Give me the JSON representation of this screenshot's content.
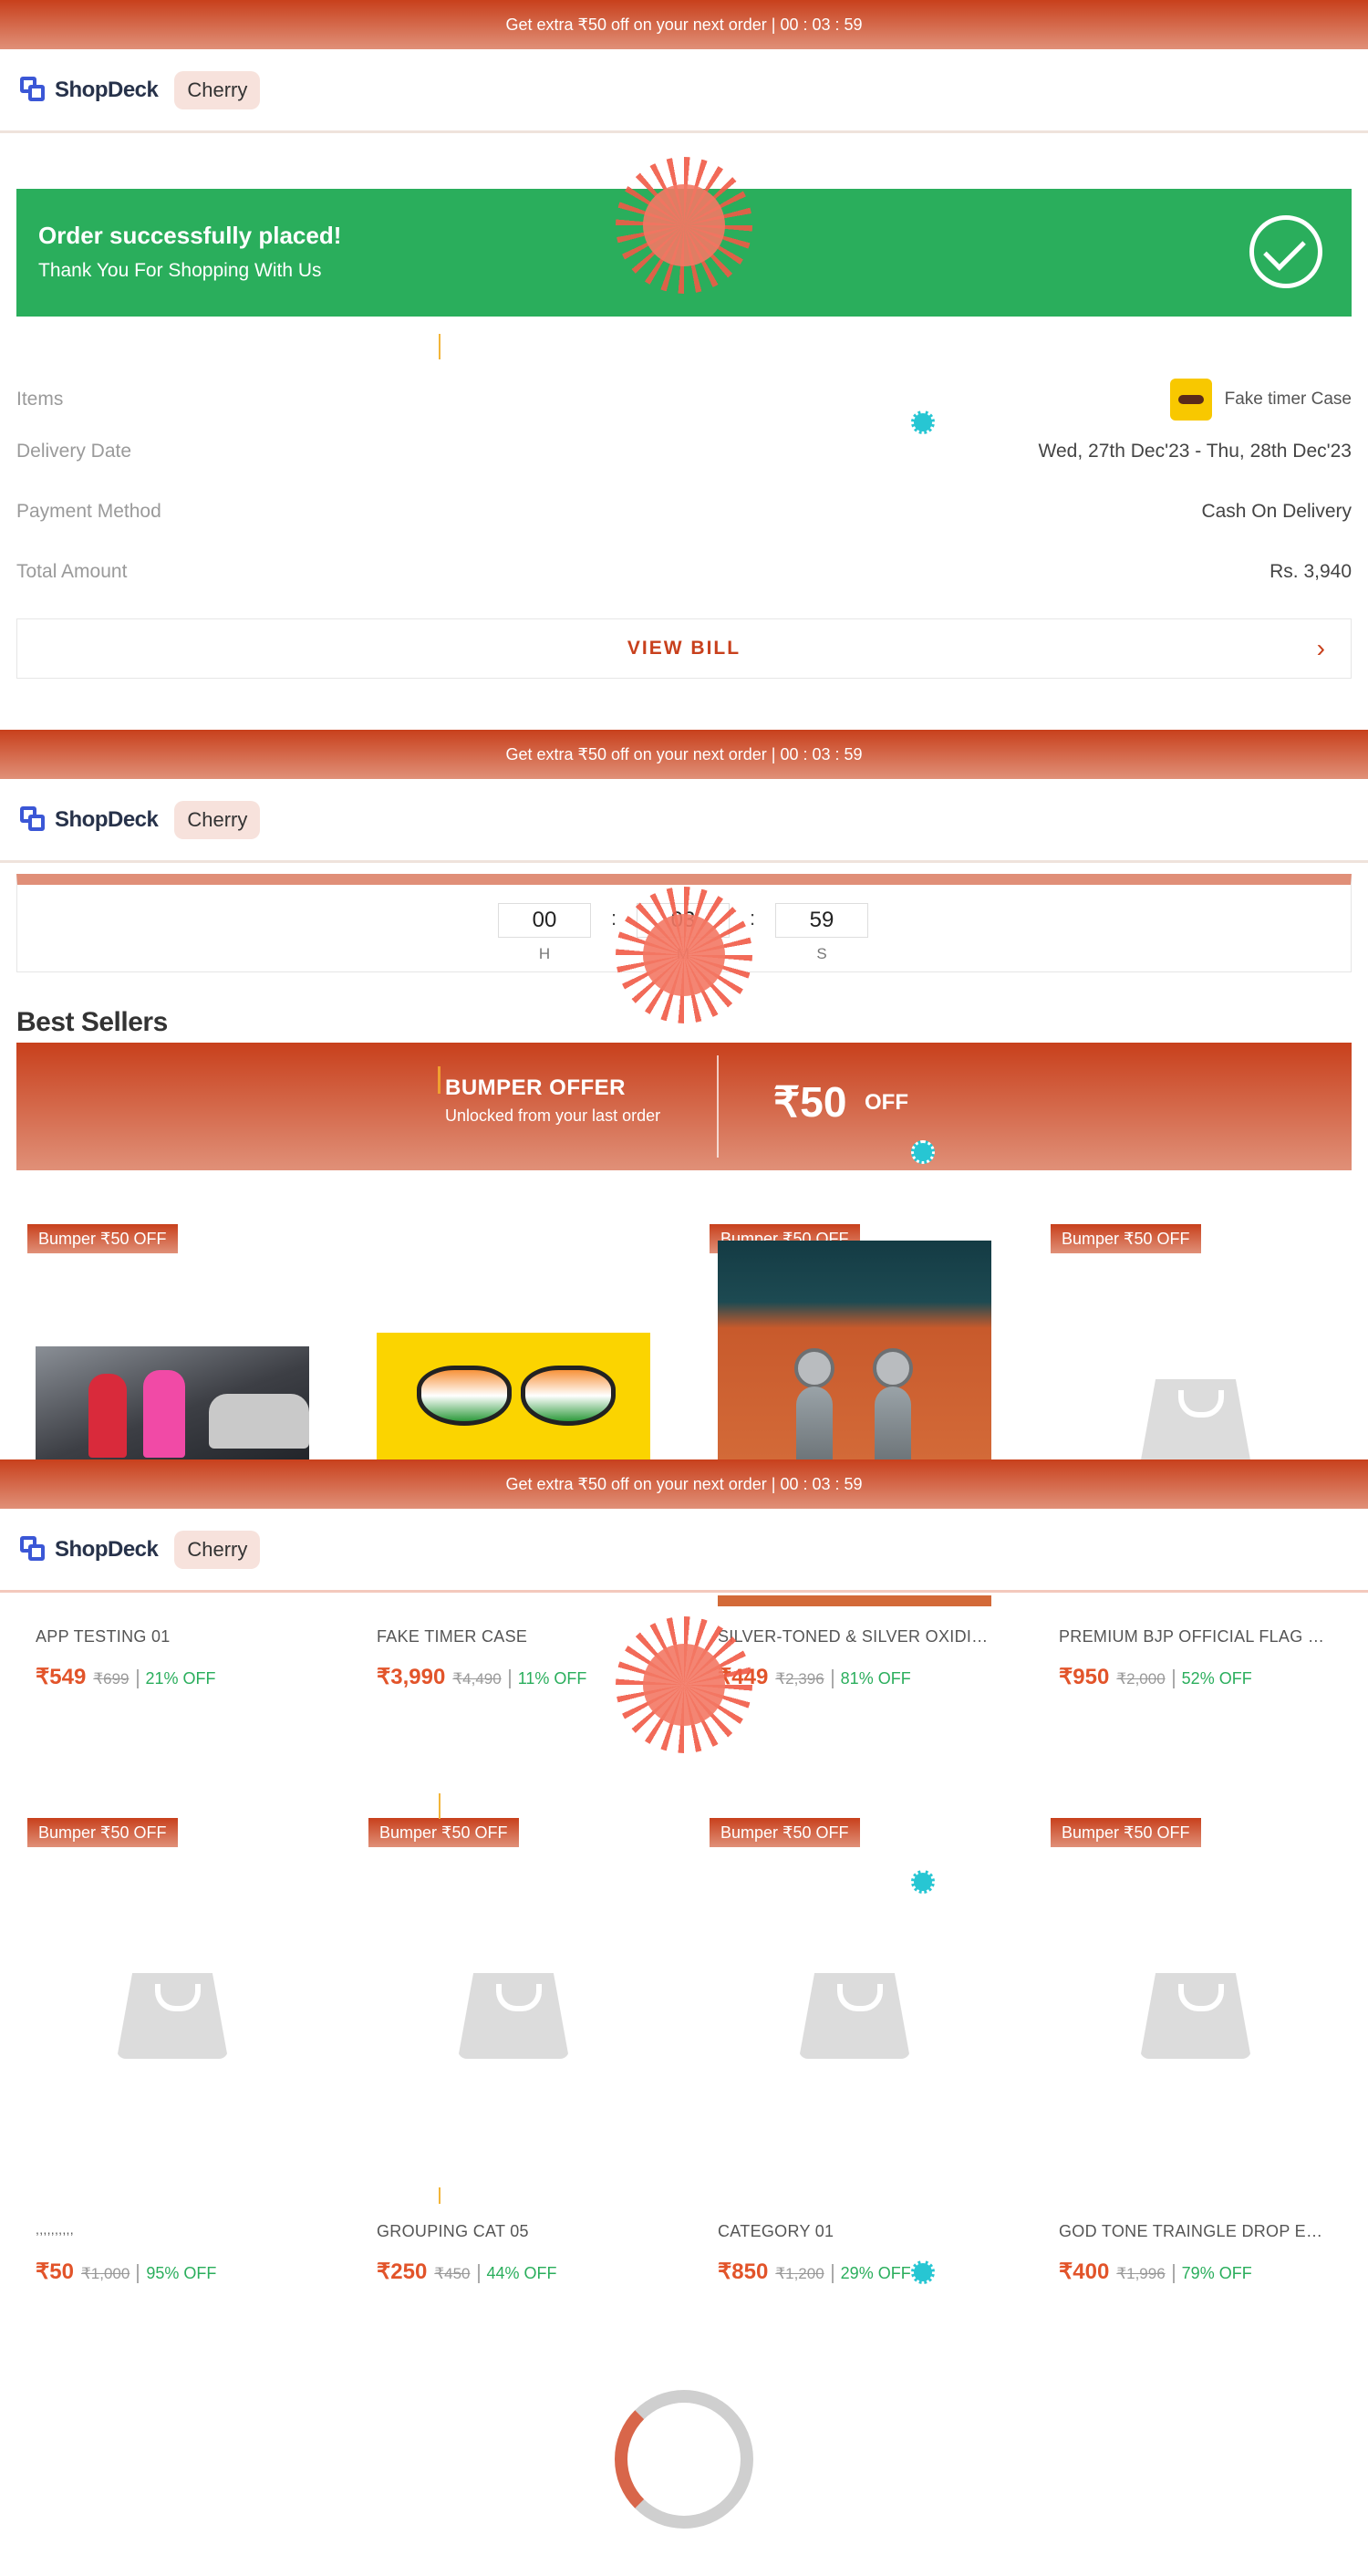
{
  "promo": {
    "text": "Get extra ₹50 off on your next order | 00 : 03 : 59"
  },
  "nav": {
    "logo_text": "ShopDeck",
    "store_name": "Cherry"
  },
  "success": {
    "title": "Order successfully placed!",
    "subtitle": "Thank You For Shopping With Us",
    "icon": "check-circle-icon"
  },
  "order": {
    "items_label": "Items",
    "item_name": "Fake timer Case",
    "delivery_label": "Delivery Date",
    "delivery_value": "Wed, 27th Dec'23 - Thu, 28th Dec'23",
    "payment_label": "Payment Method",
    "payment_value": "Cash On Delivery",
    "total_label": "Total Amount",
    "total_value": "Rs. 3,940",
    "view_bill": "VIEW BILL",
    "chevron": "›"
  },
  "timer": {
    "hours": "00",
    "minutes": "03",
    "seconds": "59",
    "h_label": "H",
    "m_label": "M",
    "s_label": "S",
    "sep": ":"
  },
  "best_sellers": {
    "title": "Best Sellers"
  },
  "bumper": {
    "title": "BUMPER OFFER",
    "subtitle": "Unlocked from your last order",
    "amount": "₹50",
    "off": "OFF"
  },
  "tag_text": "Bumper ₹50 OFF",
  "products": [
    {
      "name": "APP TESTING 01",
      "price": "₹549",
      "mrp": "₹699",
      "discount": "21% OFF",
      "image": "fashion-photo"
    },
    {
      "name": "FAKE TIMER CASE",
      "price": "₹3,990",
      "mrp": "₹4,490",
      "discount": "11% OFF",
      "image": "sunglasses-photo"
    },
    {
      "name": "SILVER-TONED & SILVER OXIDIS...",
      "price": "₹449",
      "mrp": "₹2,396",
      "discount": "81% OFF",
      "image": "earrings-photo"
    },
    {
      "name": "PREMIUM BJP OFFICIAL FLAG E...",
      "price": "₹950",
      "mrp": "₹2,000",
      "discount": "52% OFF",
      "image": "placeholder-bag"
    },
    {
      "name": ",,,,,,,,,,",
      "price": "₹50",
      "mrp": "₹1,000",
      "discount": "95% OFF",
      "image": "placeholder-bag"
    },
    {
      "name": "GROUPING CAT 05",
      "price": "₹250",
      "mrp": "₹450",
      "discount": "44% OFF",
      "image": "placeholder-bag"
    },
    {
      "name": "CATEGORY 01",
      "price": "₹850",
      "mrp": "₹1,200",
      "discount": "29% OFF",
      "image": "placeholder-bag"
    },
    {
      "name": "GOD TONE TRAINGLE DROP EAR...",
      "price": "₹400",
      "mrp": "₹1,996",
      "discount": "79% OFF",
      "image": "placeholder-bag"
    }
  ],
  "colors": {
    "brand": "#c8401c",
    "success": "#2aae5c",
    "price": "#e2542a",
    "discount": "#2aae5c",
    "logo": "#3b57d6"
  }
}
